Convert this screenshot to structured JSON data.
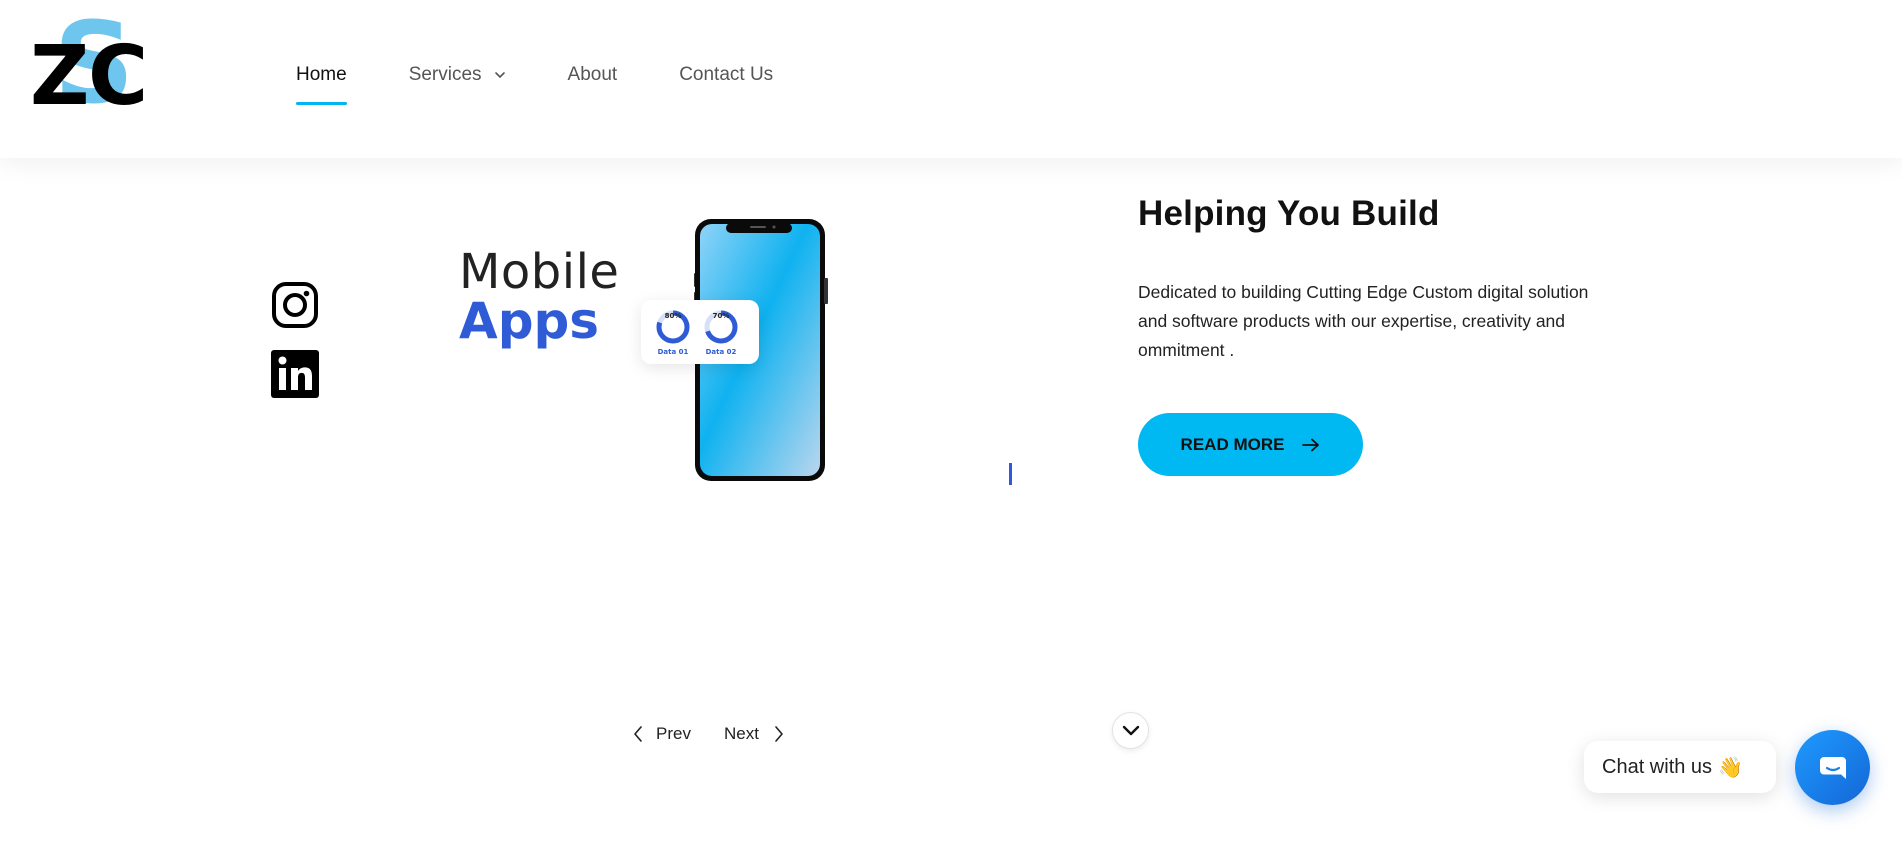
{
  "nav": {
    "items": [
      {
        "label": "Home",
        "active": true
      },
      {
        "label": "Services",
        "active": false
      },
      {
        "label": "About",
        "active": false
      },
      {
        "label": "Contact Us",
        "active": false
      }
    ]
  },
  "social": {
    "icons": [
      "instagram-icon",
      "linkedin-icon"
    ]
  },
  "illustration": {
    "line1": "Mobile",
    "line2": "Apps",
    "donut1_value": "80%",
    "donut1_label": "Data 01",
    "donut2_value": "70%",
    "donut2_label": "Data 02"
  },
  "hero": {
    "title": "Helping You Build",
    "description": "Dedicated to building Cutting Edge Custom digital solution and software products with our expertise, creativity and ommitment .",
    "cta_label": "READ MORE"
  },
  "slider": {
    "prev_label": "Prev",
    "next_label": "Next"
  },
  "chat": {
    "label": "Chat with us",
    "emoji": "👋"
  },
  "colors": {
    "accent": "#00b8f2",
    "brand_blue": "#2f5cd6",
    "chat_blue": "#1466d6"
  }
}
